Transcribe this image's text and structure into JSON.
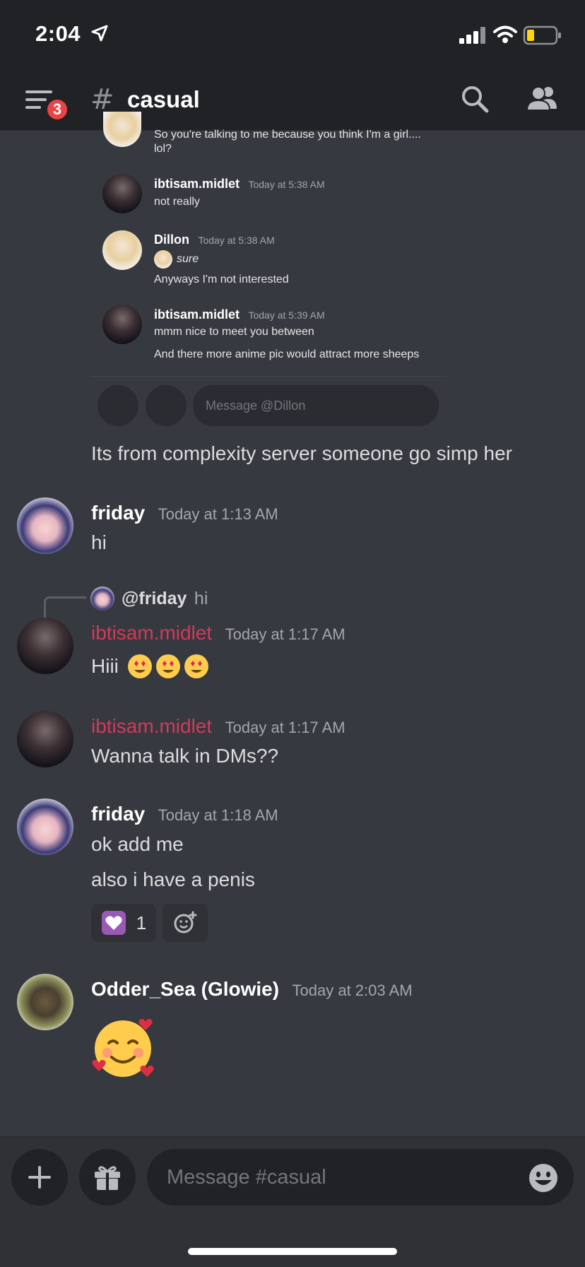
{
  "status": {
    "time": "2:04"
  },
  "header": {
    "badge_count": "3",
    "channel_name": "casual"
  },
  "embed": {
    "messages": [
      {
        "name": "",
        "time": "",
        "lines": [
          "So you're talking to me because you think I'm a girl....",
          "lol?"
        ]
      },
      {
        "name": "ibtisam.midlet",
        "time": "Today at 5:38 AM",
        "lines": [
          "not really"
        ]
      },
      {
        "name": "Dillon",
        "time": "Today at 5:38 AM",
        "reply": "sure",
        "lines": [
          "Anyways I'm not interested"
        ]
      },
      {
        "name": "ibtisam.midlet",
        "time": "Today at 5:39 AM",
        "lines": [
          "mmm nice to meet you between",
          "And there more anime pic would attract more sheeps"
        ]
      }
    ],
    "input_placeholder": "Message @Dillon"
  },
  "messages": {
    "caption": "Its from complexity server someone go simp her",
    "friday1": {
      "name": "friday",
      "time": "Today at 1:13 AM",
      "text": "hi"
    },
    "reply_ref": {
      "mention": "@friday",
      "text": "hi"
    },
    "ibtisam1": {
      "name": "ibtisam.midlet",
      "time": "Today at 1:17 AM",
      "text": "Hiii"
    },
    "ibtisam2": {
      "name": "ibtisam.midlet",
      "time": "Today at 1:17 AM",
      "text": "Wanna talk in DMs??"
    },
    "friday2": {
      "name": "friday",
      "time": "Today at 1:18 AM",
      "line1": "ok add me",
      "line2": "also i have a penis",
      "reaction_count": "1"
    },
    "odder": {
      "name": "Odder_Sea (Glowie)",
      "time": "Today at 2:03 AM"
    }
  },
  "composer": {
    "placeholder": "Message #casual"
  },
  "colors": {
    "background": "#36393f",
    "header": "#202225",
    "accent_red": "#ed4245",
    "name_red": "#d23a5c"
  },
  "icons": [
    "location-arrow-icon",
    "signal-icon",
    "wifi-icon",
    "battery-icon",
    "menu-icon",
    "hash-icon",
    "search-icon",
    "members-icon",
    "plus-icon",
    "gift-icon",
    "emoji-icon",
    "add-reaction-icon"
  ]
}
